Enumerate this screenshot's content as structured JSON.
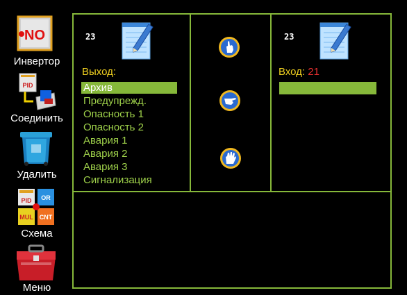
{
  "sidebar": {
    "items": [
      {
        "label": "Инвертор",
        "icon": "inverter-no-icon",
        "badge": "NO"
      },
      {
        "label": "Соединить",
        "icon": "connect-icon",
        "badge": "PID"
      },
      {
        "label": "Удалить",
        "icon": "trash-bin-icon"
      },
      {
        "label": "Схема",
        "icon": "scheme-icon",
        "tiles": [
          "PID",
          "OR",
          "MUL",
          "CNT"
        ]
      },
      {
        "label": "Меню",
        "icon": "toolbox-icon"
      }
    ]
  },
  "output_panel": {
    "doc_number": "23",
    "label": "Выход:",
    "items": [
      "Архив",
      "Предупрежд.",
      "Опасность 1",
      "Опасность 2",
      "Авария 1",
      "Авария 2",
      "Авария 3",
      "Сигнализация"
    ],
    "selected_index": 0
  },
  "input_panel": {
    "doc_number": "23",
    "label": "Вход:",
    "value": "21"
  },
  "colors": {
    "grid": "#86b83a",
    "list_text": "#9ed04a",
    "label_yellow": "#f0d020",
    "value_red": "#e83030",
    "background": "#000000"
  }
}
